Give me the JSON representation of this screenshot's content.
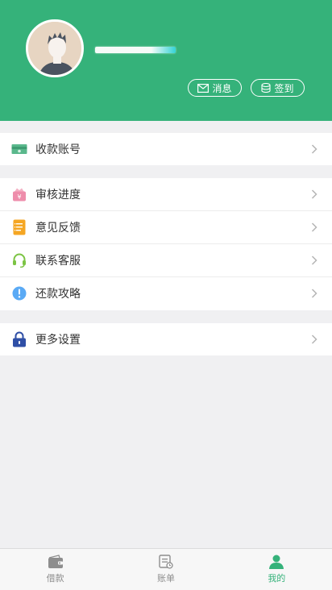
{
  "header": {
    "bg_color": "#35b27a",
    "buttons": [
      {
        "label": "消息",
        "icon": "envelope-icon"
      },
      {
        "label": "签到",
        "icon": "coins-icon"
      }
    ]
  },
  "menu": {
    "group1": [
      {
        "label": "收款账号",
        "icon": "money-card-icon",
        "color": "#5ab88c"
      }
    ],
    "group2": [
      {
        "label": "审核进度",
        "icon": "wallet-yen-icon",
        "color": "#ee8dab"
      },
      {
        "label": "意见反馈",
        "icon": "notepad-icon",
        "color": "#f5a623"
      },
      {
        "label": "联系客服",
        "icon": "headset-icon",
        "color": "#7cc444"
      },
      {
        "label": "还款攻略",
        "icon": "info-icon",
        "color": "#5aaaf5"
      }
    ],
    "group3": [
      {
        "label": "更多设置",
        "icon": "lock-icon",
        "color": "#2f4fa6"
      }
    ]
  },
  "tabbar": {
    "tabs": [
      {
        "label": "借款",
        "icon": "wallet-icon",
        "active": false
      },
      {
        "label": "账单",
        "icon": "bill-icon",
        "active": false
      },
      {
        "label": "我的",
        "icon": "user-icon",
        "active": true
      }
    ],
    "active_color": "#35b27a",
    "inactive_color": "#8e8e8e"
  }
}
